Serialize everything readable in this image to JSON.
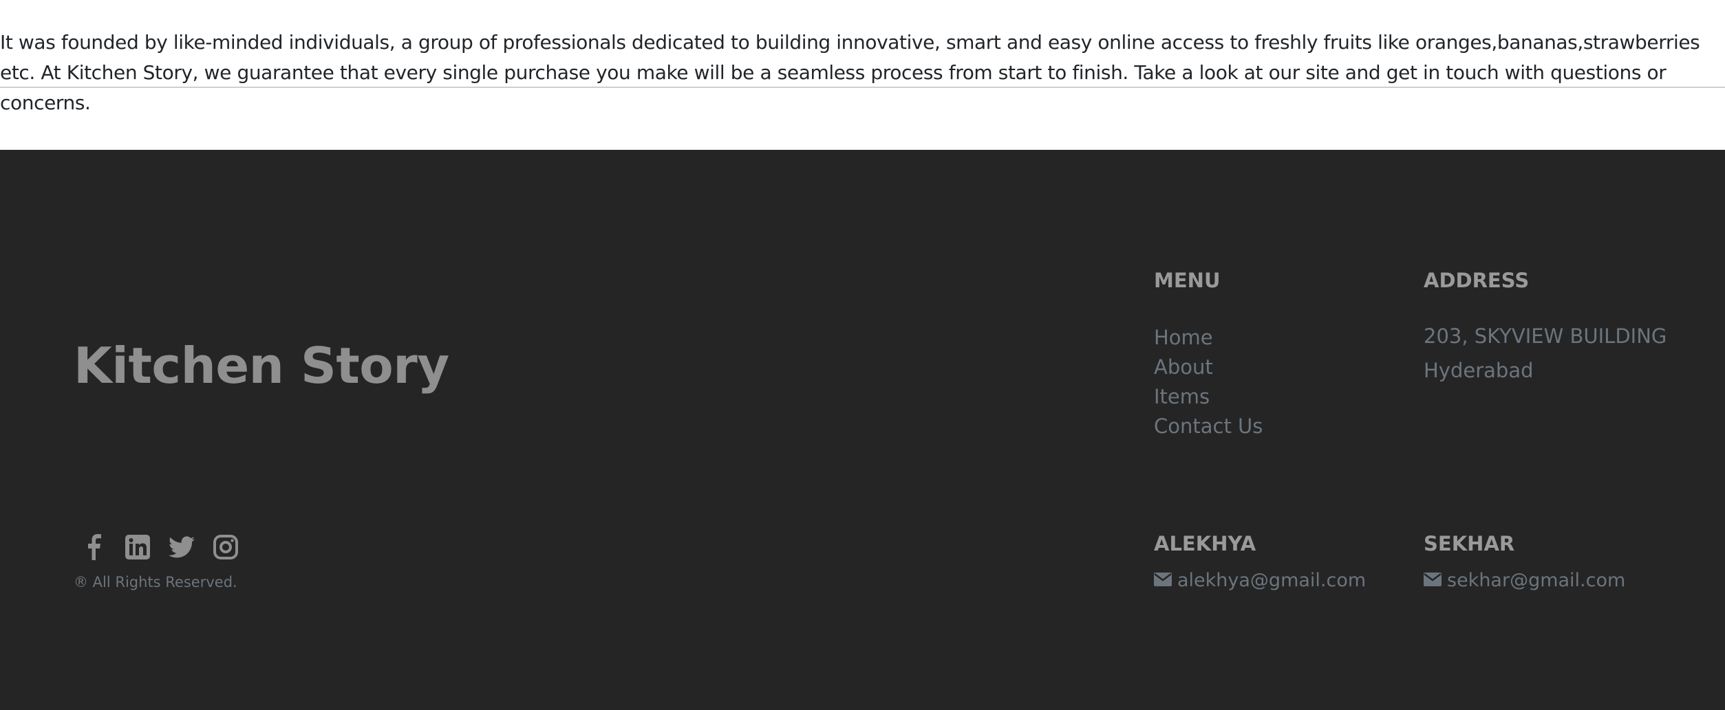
{
  "about": {
    "paragraph": "It was founded by like-minded individuals, a group of professionals dedicated to building innovative, smart and easy online access to freshly fruits like oranges,bananas,strawberries etc. At Kitchen Story, we guarantee that every single purchase you make will be a seamless process from start to finish. Take a look at our site and get in touch with questions or concerns."
  },
  "footer": {
    "brand": "Kitchen Story",
    "rights": "® All Rights Reserved.",
    "social_icons": [
      "facebook-icon",
      "linkedin-icon",
      "twitter-icon",
      "instagram-icon"
    ],
    "menu": {
      "heading": "MENU",
      "items": [
        "Home",
        "About",
        "Items",
        "Contact Us"
      ]
    },
    "address": {
      "heading": "ADDRESS",
      "line1": "203, SKYVIEW BUILDING",
      "line2": "Hyderabad"
    },
    "contacts": [
      {
        "name": "ALEKHYA",
        "email": "alekhya@gmail.com",
        "icon": "envelope-icon"
      },
      {
        "name": "SEKHAR",
        "email": "sekhar@gmail.com",
        "icon": "envelope-icon"
      }
    ],
    "colors": {
      "background": "#252525",
      "heading": "#9a9a9a",
      "link": "#6c757d"
    }
  }
}
